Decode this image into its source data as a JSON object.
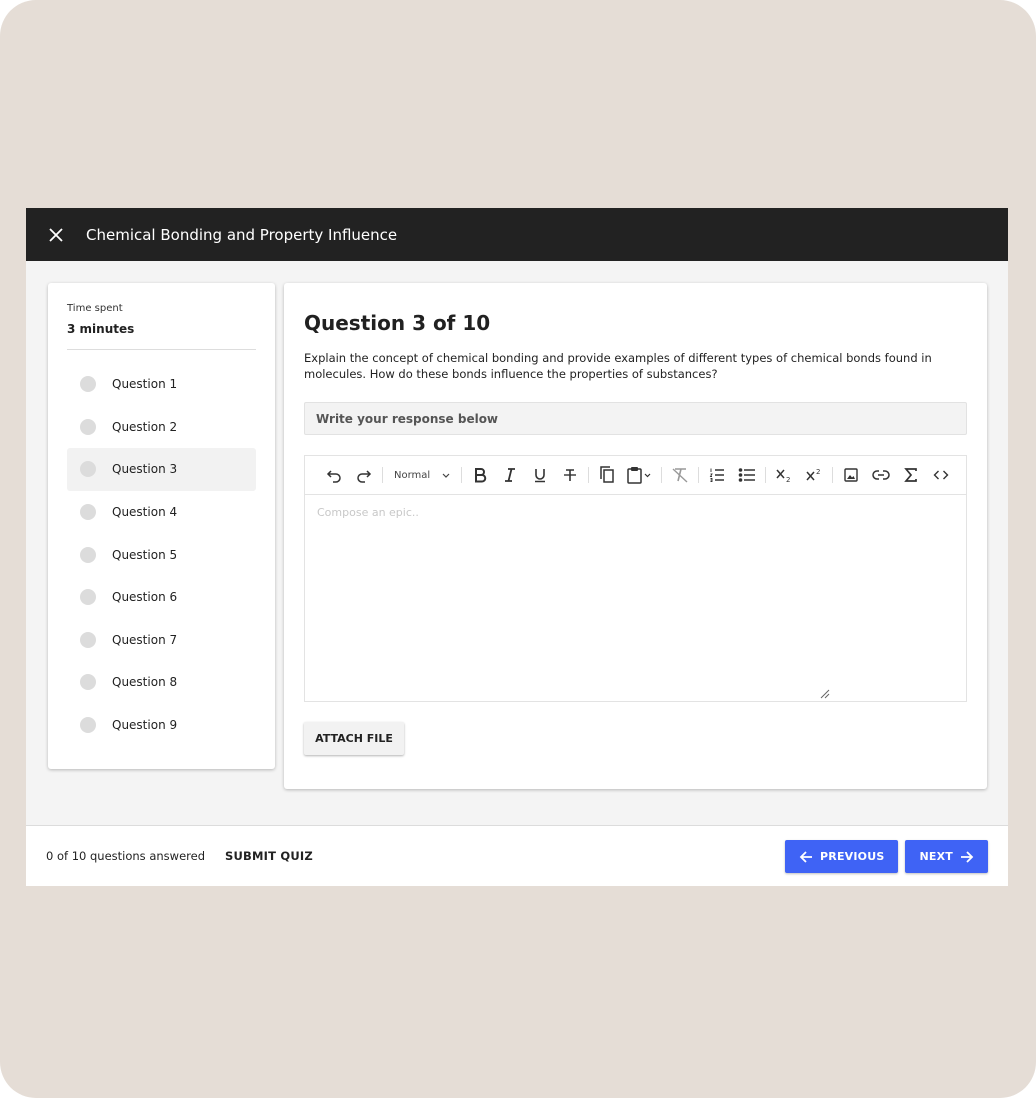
{
  "header": {
    "title": "Chemical Bonding and Property Influence"
  },
  "sidebar": {
    "time_label": "Time spent",
    "time_value": "3 minutes",
    "questions": [
      {
        "label": "Question 1"
      },
      {
        "label": "Question 2"
      },
      {
        "label": "Question 3",
        "active": true
      },
      {
        "label": "Question 4"
      },
      {
        "label": "Question 5"
      },
      {
        "label": "Question 6"
      },
      {
        "label": "Question 7"
      },
      {
        "label": "Question 8"
      },
      {
        "label": "Question 9"
      }
    ]
  },
  "main": {
    "question_title": "Question 3 of 10",
    "question_text": "Explain the concept of chemical bonding and provide examples of different types of chemical bonds found in molecules. How do these bonds influence the properties of substances?",
    "response_label": "Write your response below",
    "editor": {
      "format_select": "Normal",
      "placeholder": "Compose an epic..",
      "toolbar_icons": [
        "undo-icon",
        "redo-icon",
        "bold-icon",
        "italic-icon",
        "underline-icon",
        "strikethrough-icon",
        "copy-icon",
        "paste-icon",
        "clear-format-icon",
        "ordered-list-icon",
        "bullet-list-icon",
        "subscript-icon",
        "superscript-icon",
        "image-icon",
        "link-icon",
        "sigma-icon",
        "code-icon"
      ]
    },
    "attach_label": "ATTACH FILE"
  },
  "footer": {
    "answered": "0 of 10 questions answered",
    "submit_label": "SUBMIT QUIZ",
    "previous_label": "PREVIOUS",
    "next_label": "NEXT"
  },
  "colors": {
    "background": "#e5ddd6",
    "topbar": "#222222",
    "primary": "#3f63f5"
  }
}
